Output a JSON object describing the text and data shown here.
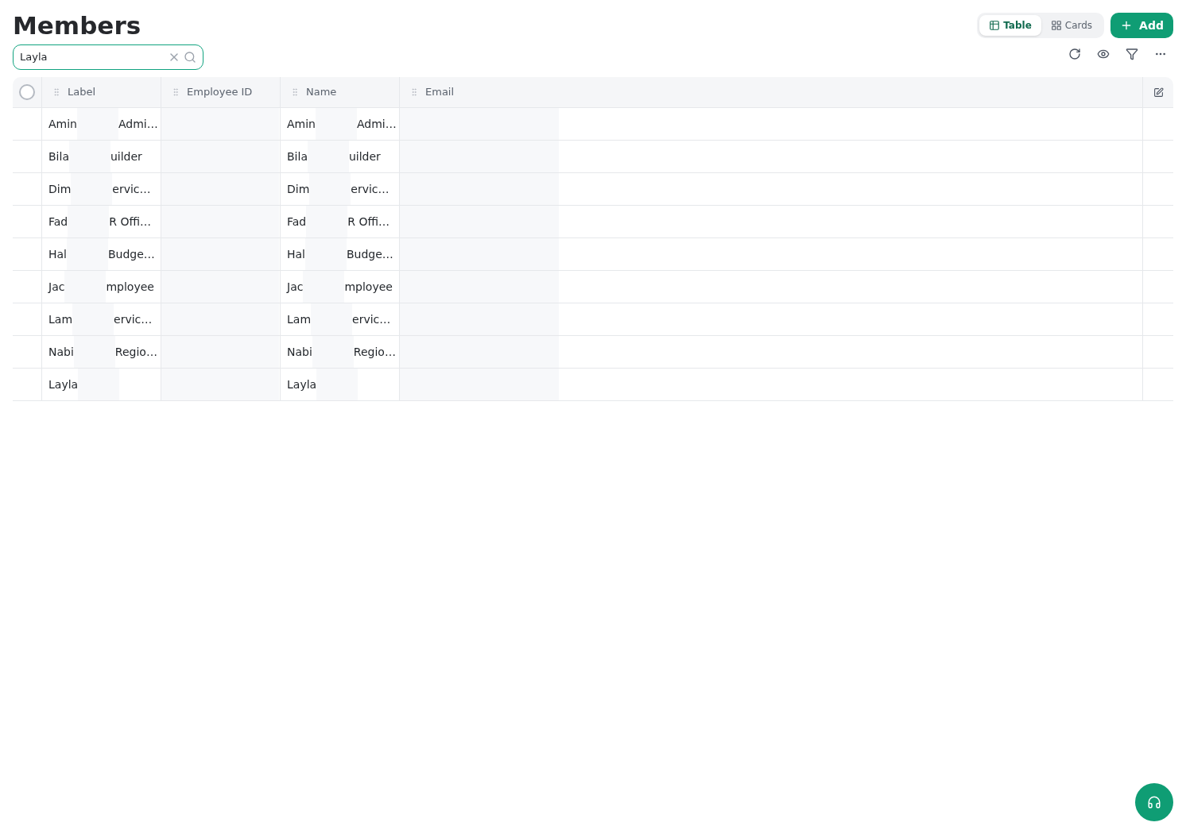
{
  "page": {
    "title": "Members"
  },
  "search": {
    "value": "Layla"
  },
  "view_toggle": [
    {
      "label": "Table",
      "selected": true
    },
    {
      "label": "Cards",
      "selected": false
    }
  ],
  "add_button": {
    "label": "Add"
  },
  "table": {
    "select_all": {
      "checked": false
    },
    "columns": [
      "Label",
      "Employee ID",
      "Name",
      "Email"
    ],
    "rows": [
      {
        "label": {
          "start": "Amin",
          "end": "Admi…"
        },
        "name": {
          "start": "Amin",
          "end": "Admi…"
        }
      },
      {
        "label": {
          "start": "Bila",
          "end": "uilder"
        },
        "name": {
          "start": "Bila",
          "end": "uilder"
        }
      },
      {
        "label": {
          "start": "Dim",
          "end": "ervic…"
        },
        "name": {
          "start": "Dim",
          "end": "ervic…"
        }
      },
      {
        "label": {
          "start": "Fad",
          "end": "R Offi…"
        },
        "name": {
          "start": "Fad",
          "end": "R Offi…"
        }
      },
      {
        "label": {
          "start": "Hal",
          "end": "Budge…"
        },
        "name": {
          "start": "Hal",
          "end": "Budge…"
        }
      },
      {
        "label": {
          "start": "Jac",
          "end": "mployee"
        },
        "name": {
          "start": "Jac",
          "end": "mployee"
        }
      },
      {
        "label": {
          "start": "Lam",
          "end": "ervic…"
        },
        "name": {
          "start": "Lam",
          "end": "ervic…"
        }
      },
      {
        "label": {
          "start": "Nabi",
          "end": "Regio…"
        },
        "name": {
          "start": "Nabi",
          "end": "Regio…"
        }
      },
      {
        "label": {
          "start": "Layla"
        },
        "name": {
          "start": "Layla"
        }
      }
    ]
  }
}
